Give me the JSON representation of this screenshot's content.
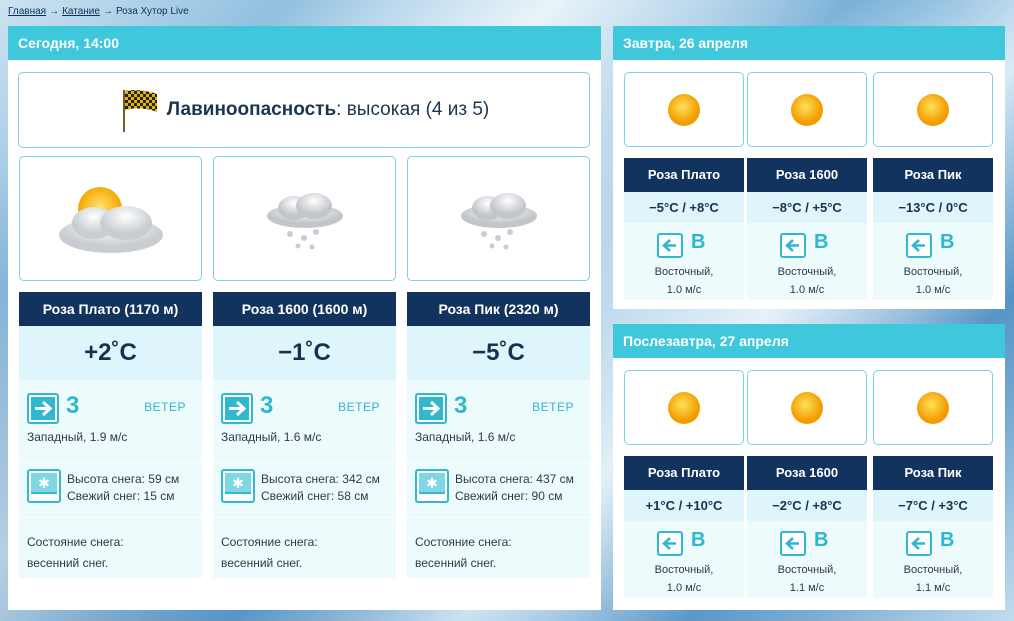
{
  "breadcrumb": {
    "home": "Главная",
    "section": "Катание",
    "current": "Роза Хутор Live",
    "sep": "→"
  },
  "today": {
    "title": "Сегодня, 14:00",
    "avalanche": {
      "label": "Лавиноопасность",
      "value": ": высокая (4 из 5)"
    },
    "stations": [
      {
        "name": "Роза Плато (1170 м)",
        "weather_icon": "partly-cloudy-icon",
        "temp": "+2˚C",
        "wind_speed": "3",
        "wind_label": "ВЕТЕР",
        "wind_desc": "Западный, 1.9 м/с",
        "snow_height": "Высота снега: 59 см",
        "fresh_snow": "Свежий снег: 15 см",
        "cond_label": "Состояние снега:",
        "cond_value": "весенний снег."
      },
      {
        "name": "Роза 1600 (1600 м)",
        "weather_icon": "snow-cloud-icon",
        "temp": "−1˚C",
        "wind_speed": "3",
        "wind_label": "ВЕТЕР",
        "wind_desc": "Западный, 1.6 м/с",
        "snow_height": "Высота снега: 342 см",
        "fresh_snow": "Свежий снег: 58 см",
        "cond_label": "Состояние снега:",
        "cond_value": "весенний снег."
      },
      {
        "name": "Роза Пик (2320 м)",
        "weather_icon": "snow-cloud-icon",
        "temp": "−5˚C",
        "wind_speed": "3",
        "wind_label": "ВЕТЕР",
        "wind_desc": "Западный, 1.6 м/с",
        "snow_height": "Высота снега: 437 см",
        "fresh_snow": "Свежий снег: 90 см",
        "cond_label": "Состояние снега:",
        "cond_value": "весенний снег."
      }
    ]
  },
  "tomorrow": {
    "title": "Завтра, 26 апреля",
    "stations": [
      {
        "name": "Роза Плато",
        "temp": "−5°C / +8°C",
        "dir": "В",
        "wind_desc": "Восточный,",
        "wind_speed": "1.0 м/с"
      },
      {
        "name": "Роза 1600",
        "temp": "−8°C / +5°C",
        "dir": "В",
        "wind_desc": "Восточный,",
        "wind_speed": "1.0 м/с"
      },
      {
        "name": "Роза Пик",
        "temp": "−13°C / 0°C",
        "dir": "В",
        "wind_desc": "Восточный,",
        "wind_speed": "1.0 м/с"
      }
    ]
  },
  "after": {
    "title": "Послезавтра, 27 апреля",
    "stations": [
      {
        "name": "Роза Плато",
        "temp": "+1°C / +10°C",
        "dir": "В",
        "wind_desc": "Восточный,",
        "wind_speed": "1.0 м/с"
      },
      {
        "name": "Роза 1600",
        "temp": "−2°C / +8°C",
        "dir": "В",
        "wind_desc": "Восточный,",
        "wind_speed": "1.1 м/с"
      },
      {
        "name": "Роза Пик",
        "temp": "−7°C / +3°C",
        "dir": "В",
        "wind_desc": "Восточный,",
        "wind_speed": "1.1 м/с"
      }
    ]
  },
  "colors": {
    "header": "#3fc7dc",
    "station_bar": "#12335e",
    "accent": "#2eb8cf"
  }
}
